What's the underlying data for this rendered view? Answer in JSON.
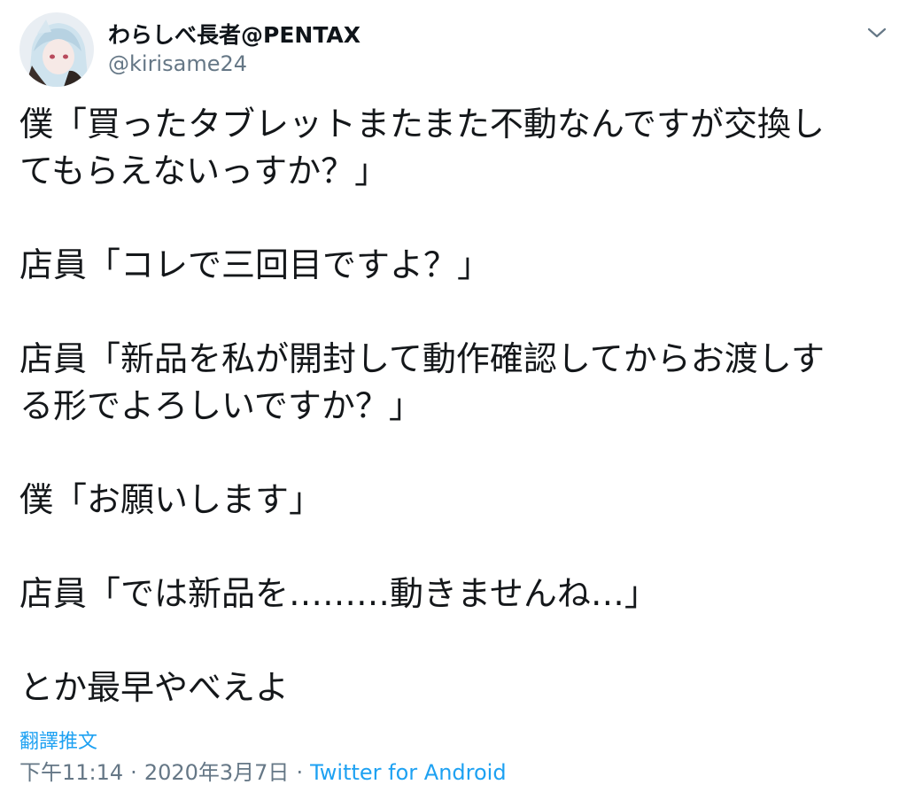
{
  "author": {
    "display_name": "わらしべ長者@PENTAX",
    "handle": "@kirisame24"
  },
  "icons": {
    "menu": "chevron-down-icon",
    "avatar": "user-avatar"
  },
  "tweet": {
    "lines": [
      "僕「買ったタブレットまたまた不動なんですが交換し",
      "てもらえないっすか？」",
      "",
      "店員「コレで三回目ですよ？」",
      "",
      "店員「新品を私が開封して動作確認してからお渡しす",
      "る形でよろしいですか？」",
      "",
      "僕「お願いします」",
      "",
      "店員「では新品を………動きませんね…」",
      "",
      "とか最早やべえよ"
    ]
  },
  "translate_label": "翻譯推文",
  "meta": {
    "time": "下午11:14",
    "separator": "·",
    "date": "2020年3月7日",
    "source": "Twitter for Android"
  },
  "colors": {
    "text": "#14171a",
    "secondary": "#657786",
    "link": "#1da1f2"
  }
}
